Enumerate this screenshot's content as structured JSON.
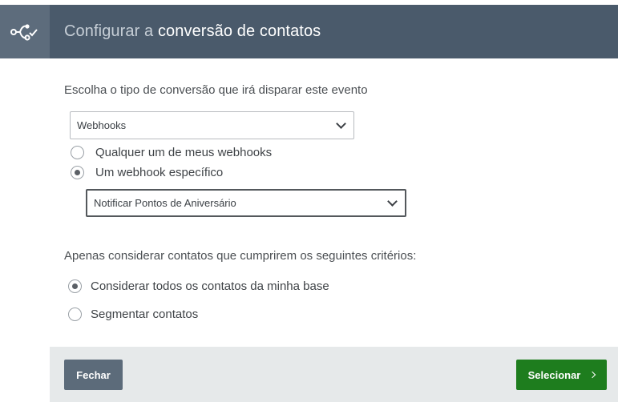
{
  "header": {
    "title_prefix": "Configurar a",
    "title_strong": "conversão de contatos",
    "icon": "webhook-flow-icon"
  },
  "conversion": {
    "label": "Escolha o tipo de conversão que irá disparar este evento",
    "type_select_value": "Webhooks",
    "options": [
      {
        "label": "Qualquer um de meus webhooks",
        "checked": false
      },
      {
        "label": "Um webhook específico",
        "checked": true
      }
    ],
    "webhook_select_value": "Notificar Pontos de Aniversário"
  },
  "criteria": {
    "label": "Apenas considerar contatos que cumprirem os seguintes critérios:",
    "options": [
      {
        "label": "Considerar todos os contatos da minha base",
        "checked": true
      },
      {
        "label": "Segmentar contatos",
        "checked": false
      }
    ]
  },
  "footer": {
    "close_label": "Fechar",
    "select_label": "Selecionar"
  },
  "colors": {
    "header_bg": "#4a5a6b",
    "primary_button": "#1e7d1e",
    "secondary_button": "#5c6b7a"
  }
}
